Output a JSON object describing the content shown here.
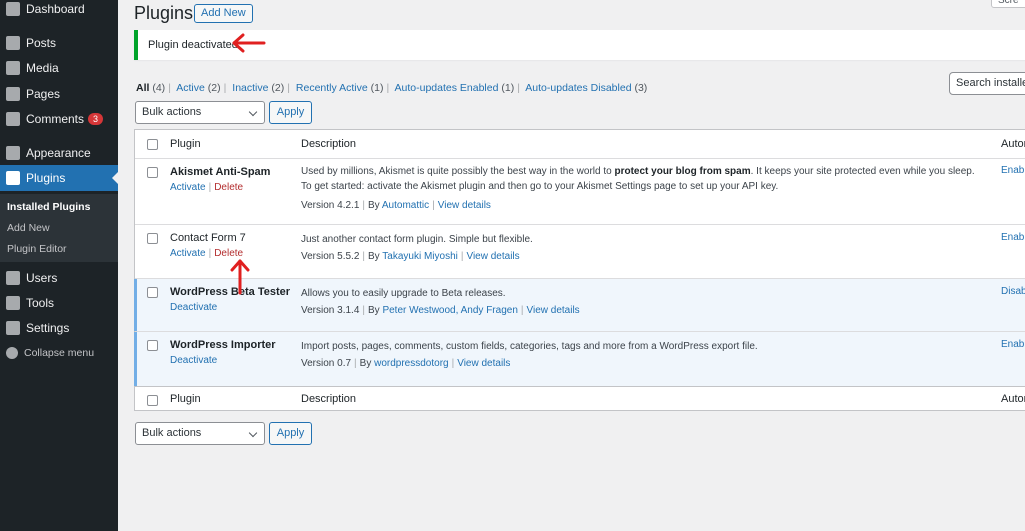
{
  "sidebar": {
    "dashboard": "Dashboard",
    "posts": "Posts",
    "media": "Media",
    "pages": "Pages",
    "comments": "Comments",
    "comments_badge": "3",
    "appearance": "Appearance",
    "plugins": "Plugins",
    "submenu": {
      "installed": "Installed Plugins",
      "add_new": "Add New",
      "editor": "Plugin Editor"
    },
    "users": "Users",
    "tools": "Tools",
    "settings": "Settings",
    "collapse": "Collapse menu"
  },
  "header": {
    "title": "Plugins",
    "add_new": "Add New",
    "screen_options": "Scre"
  },
  "notice": {
    "text": "Plugin deactivated."
  },
  "filters": {
    "all": "All",
    "all_count": "(4)",
    "active": "Active",
    "active_count": "(2)",
    "inactive": "Inactive",
    "inactive_count": "(2)",
    "recent": "Recently Active",
    "recent_count": "(1)",
    "au_enabled": "Auto-updates Enabled",
    "au_enabled_count": "(1)",
    "au_disabled": "Auto-updates Disabled",
    "au_disabled_count": "(3)",
    "separator": "|"
  },
  "search": {
    "placeholder": "Search installe"
  },
  "bulk": {
    "label": "Bulk actions",
    "apply": "Apply"
  },
  "table": {
    "col_plugin": "Plugin",
    "col_description": "Description",
    "col_auto": "Autor",
    "rows": [
      {
        "name": "Akismet Anti-Spam",
        "action1": "Activate",
        "action2": "Delete",
        "desc_pre": "Used by millions, Akismet is quite possibly the best way in the world to ",
        "desc_bold": "protect your blog from spam",
        "desc_post": ". It keeps your site protected even while you sleep.",
        "desc_line2": "To get started: activate the Akismet plugin and then go to your Akismet Settings page to set up your API key.",
        "version": "Version 4.2.1",
        "by": "By",
        "author": "Automattic",
        "details": "View details",
        "auto": "Enabl"
      },
      {
        "name": "Contact Form 7",
        "action1": "Activate",
        "action2": "Delete",
        "desc": "Just another contact form plugin. Simple but flexible.",
        "version": "Version 5.5.2",
        "by": "By",
        "author": "Takayuki Miyoshi",
        "details": "View details",
        "auto": "Enabl"
      },
      {
        "name": "WordPress Beta Tester",
        "action1": "Deactivate",
        "desc": "Allows you to easily upgrade to Beta releases.",
        "version": "Version 3.1.4",
        "by": "By",
        "author": "Peter Westwood, Andy Fragen",
        "details": "View details",
        "auto": "Disab"
      },
      {
        "name": "WordPress Importer",
        "action1": "Deactivate",
        "desc": "Import posts, pages, comments, custom fields, categories, tags and more from a WordPress export file.",
        "version": "Version 0.7",
        "by": "By",
        "author": "wordpressdotorg",
        "details": "View details",
        "auto": "Enabl"
      }
    ]
  },
  "colors": {
    "sidebar_bg": "#1d2327",
    "accent": "#2271b1",
    "success": "#00a32a",
    "delete": "#b32d2e",
    "annotation": "#e02020"
  }
}
